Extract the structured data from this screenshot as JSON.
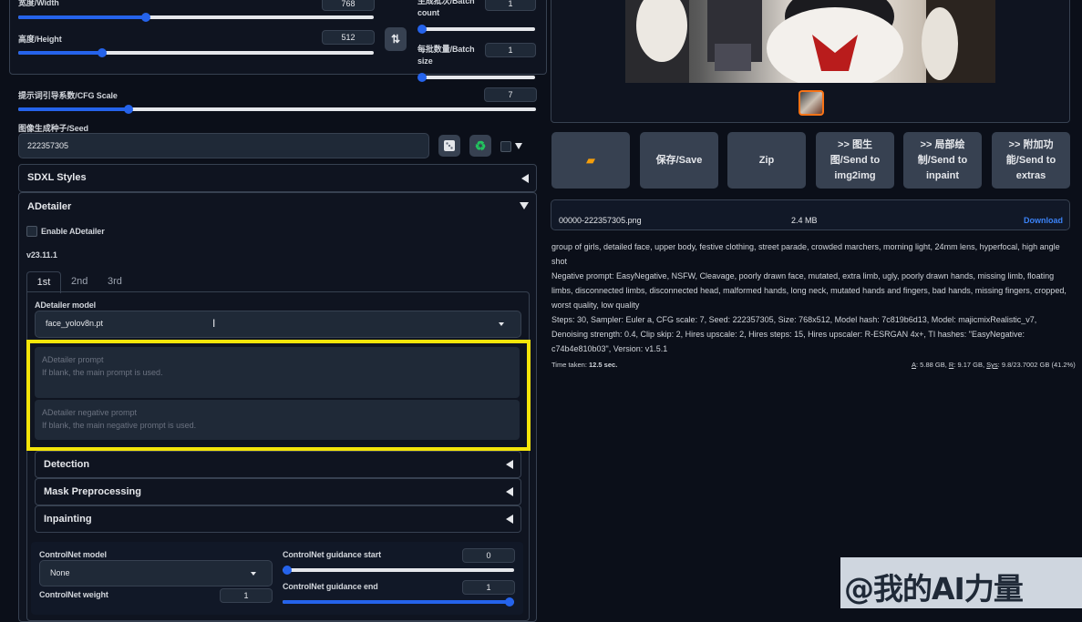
{
  "left": {
    "width": {
      "label": "宽度/Width",
      "value": "768",
      "fraction": 0.305
    },
    "height": {
      "label": "高度/Height",
      "value": "512",
      "fraction": 0.196
    },
    "swap_icon": "swap-arrows-icon",
    "batch_count": {
      "label_line1": "生成批次/Batch",
      "label_line2": "count",
      "value": "1",
      "fraction": 0.0
    },
    "batch_size": {
      "label_line1": "每批数量/Batch",
      "label_line2": "size",
      "value": "1",
      "fraction": 0.0
    },
    "cfg": {
      "label": "提示词引导系数/CFG Scale",
      "value": "7",
      "fraction": 0.214
    },
    "seed": {
      "label": "图像生成种子/Seed",
      "value": "222357305"
    },
    "sdxl_styles": "SDXL Styles",
    "adetailer": {
      "title": "ADetailer",
      "enable_label": "Enable ADetailer",
      "version": "v23.11.1",
      "tabs": [
        "1st",
        "2nd",
        "3rd"
      ],
      "model_label": "ADetailer model",
      "model_value": "face_yolov8n.pt",
      "prompt_placeholder_title": "ADetailer prompt",
      "prompt_placeholder_hint": "If blank, the main prompt is used.",
      "neg_placeholder_title": "ADetailer negative prompt",
      "neg_placeholder_hint": "If blank, the main negative prompt is used.",
      "sections": [
        "Detection",
        "Mask Preprocessing",
        "Inpainting"
      ],
      "controlnet_model_label": "ControlNet model",
      "controlnet_model_value": "None",
      "controlnet_weight_label": "ControlNet weight",
      "controlnet_weight_value": "1",
      "guidance_start_label": "ControlNet guidance start",
      "guidance_start_value": "0",
      "guidance_end_label": "ControlNet guidance end",
      "guidance_end_value": "1"
    }
  },
  "right": {
    "buttons": {
      "folder_icon": "folder-icon",
      "save": "保存/Save",
      "zip": "Zip",
      "img2img": [
        ">> 图生",
        "图/Send to",
        "img2img"
      ],
      "inpaint": [
        ">> 局部绘",
        "制/Send to",
        "inpaint"
      ],
      "extras": [
        ">> 附加功",
        "能/Send to",
        "extras"
      ]
    },
    "file": {
      "name": "00000-222357305.png",
      "size": "2.4 MB",
      "download": "Download"
    },
    "prompt": "group of girls, detailed face, upper body, festive clothing, street parade, crowded marchers, morning light, 24mm lens, hyperfocal, high angle shot",
    "negative": "Negative prompt: EasyNegative, NSFW, Cleavage, poorly drawn face, mutated, extra limb, ugly, poorly drawn hands, missing limb, floating limbs, disconnected limbs, disconnected head, malformed hands, long neck, mutated hands and fingers, bad hands, missing fingers, cropped, worst quality, low quality",
    "params": "Steps: 30, Sampler: Euler a, CFG scale: 7, Seed: 222357305, Size: 768x512, Model hash: 7c819b6d13, Model: majicmixRealistic_v7, Denoising strength: 0.4, Clip skip: 2, Hires upscale: 2, Hires steps: 15, Hires upscaler: R-ESRGAN 4x+, TI hashes: \"EasyNegative: c74b4e810b03\", Version: v1.5.1",
    "time_label": "Time taken:",
    "time_value": "12.5 sec.",
    "mem": {
      "a_label": "A",
      "a_value": ": 5.88 GB, ",
      "r_label": "R",
      "r_value": ": 9.17 GB, ",
      "sys_label": "Sys",
      "sys_value": ": 9.8/23.7002 GB (41.2%)"
    }
  },
  "watermark": "@我的AI力量",
  "colors": {
    "accent": "#2563eb",
    "highlight": "#f5e50a",
    "thumb_border": "#f97316"
  }
}
